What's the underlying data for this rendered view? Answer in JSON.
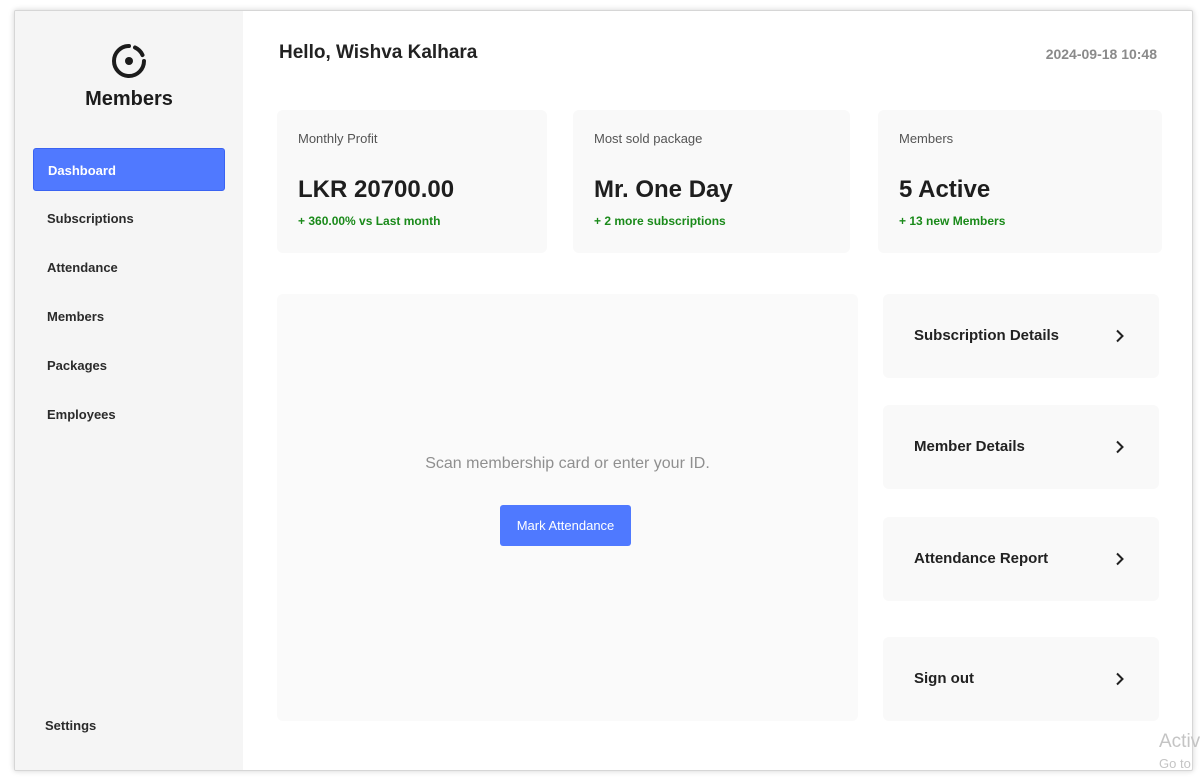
{
  "sidebar": {
    "brand": "Members",
    "logo_icon": "ring-dot-logo-icon",
    "items": [
      {
        "label": "Dashboard",
        "active": true
      },
      {
        "label": "Subscriptions",
        "active": false
      },
      {
        "label": "Attendance",
        "active": false
      },
      {
        "label": "Members",
        "active": false
      },
      {
        "label": "Packages",
        "active": false
      },
      {
        "label": "Employees",
        "active": false
      }
    ],
    "settings_label": "Settings"
  },
  "header": {
    "greeting": "Hello, Wishva Kalhara",
    "datetime": "2024-09-18 10:48"
  },
  "stats": [
    {
      "label": "Monthly Profit",
      "value": "LKR 20700.00",
      "sub": "+ 360.00% vs Last month"
    },
    {
      "label": "Most sold package",
      "value": "Mr. One Day",
      "sub": "+ 2 more subscriptions"
    },
    {
      "label": "Members",
      "value": "5 Active",
      "sub": "+ 13 new Members"
    }
  ],
  "scan": {
    "prompt": "Scan membership card or enter your ID.",
    "button_label": "Mark Attendance"
  },
  "actions": [
    {
      "label": "Subscription Details"
    },
    {
      "label": "Member Details"
    },
    {
      "label": "Attendance Report"
    },
    {
      "label": "Sign out"
    }
  ],
  "watermark": {
    "line1": "Activ",
    "line2": "Go to"
  },
  "colors": {
    "accent": "#5079ff",
    "positive": "#1a8a1a"
  }
}
